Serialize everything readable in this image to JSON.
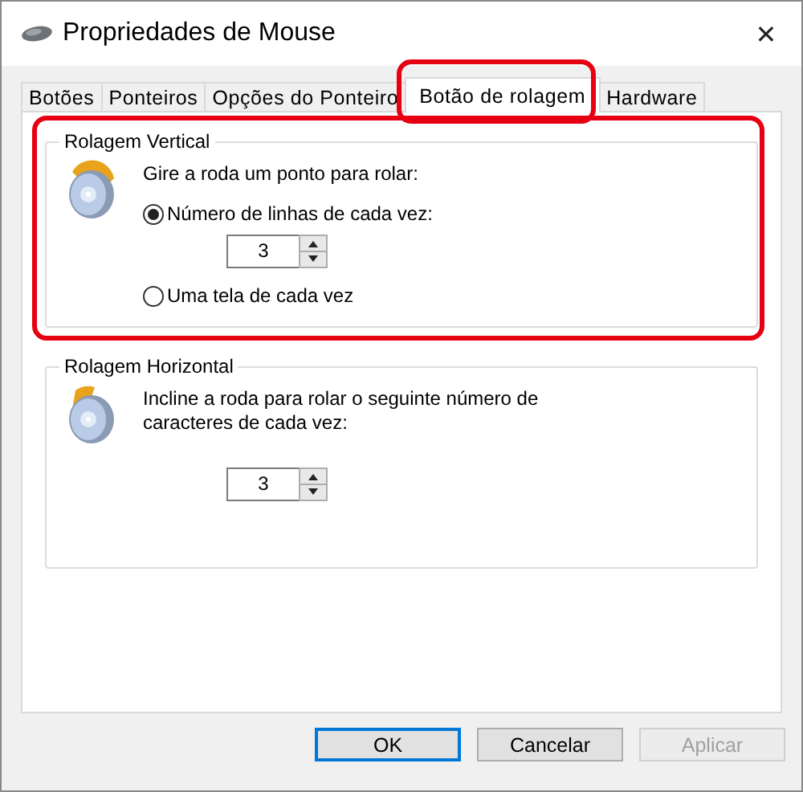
{
  "window": {
    "title": "Propriedades de Mouse",
    "close": "✕"
  },
  "tabs": [
    {
      "label": "Botões",
      "selected": false,
      "highlighted": false
    },
    {
      "label": "Ponteiros",
      "selected": false,
      "highlighted": false
    },
    {
      "label": "Opções do Ponteiro",
      "selected": false,
      "highlighted": false
    },
    {
      "label": "Botão de rolagem",
      "selected": true,
      "highlighted": true
    },
    {
      "label": "Hardware",
      "selected": false,
      "highlighted": false
    }
  ],
  "groups": [
    {
      "title": "Rolagem Vertical",
      "highlighted": true,
      "kind": "vertical",
      "description": "Gire a roda um ponto para rolar:",
      "options": [
        {
          "label": "Número de linhas de cada vez:",
          "selected": true,
          "value": "3"
        },
        {
          "label": "Uma tela de cada vez",
          "selected": false
        }
      ]
    },
    {
      "title": "Rolagem Horizontal",
      "highlighted": false,
      "kind": "horizontal",
      "description": "Incline a roda para rolar o seguinte número de caracteres de cada vez:",
      "value": "3"
    }
  ],
  "buttons": [
    {
      "label": "OK",
      "default": true,
      "disabled": false
    },
    {
      "label": "Cancelar",
      "default": false,
      "disabled": false
    },
    {
      "label": "Aplicar",
      "default": false,
      "disabled": true
    }
  ]
}
